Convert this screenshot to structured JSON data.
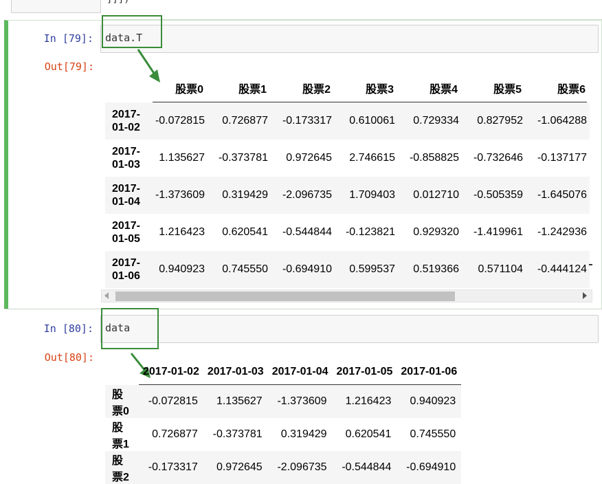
{
  "prev_cell": {
    "code_tail": "]]])"
  },
  "cell79": {
    "in_prompt": "In  [79]:",
    "out_prompt": "Out[79]:",
    "code": "data.T",
    "table": {
      "columns": [
        "股票0",
        "股票1",
        "股票2",
        "股票3",
        "股票4",
        "股票5",
        "股票6"
      ],
      "rows": [
        {
          "index": [
            "2017-",
            "01-02"
          ],
          "values": [
            "-0.072815",
            "0.726877",
            "-0.173317",
            "0.610061",
            "0.729334",
            "0.827952",
            "-1.064288"
          ]
        },
        {
          "index": [
            "2017-",
            "01-03"
          ],
          "values": [
            "1.135627",
            "-0.373781",
            "0.972645",
            "2.746615",
            "-0.858825",
            "-0.732646",
            "-0.137177"
          ]
        },
        {
          "index": [
            "2017-",
            "01-04"
          ],
          "values": [
            "-1.373609",
            "0.319429",
            "-2.096735",
            "1.709403",
            "0.012710",
            "-0.505359",
            "-1.645076"
          ]
        },
        {
          "index": [
            "2017-",
            "01-05"
          ],
          "values": [
            "1.216423",
            "0.620541",
            "-0.544844",
            "-0.123821",
            "0.929320",
            "-1.419961",
            "-1.242936"
          ]
        },
        {
          "index": [
            "2017-",
            "01-06"
          ],
          "values": [
            "0.940923",
            "0.745550",
            "-0.694910",
            "0.599537",
            "0.519366",
            "0.571104",
            "-0.444124"
          ]
        }
      ]
    }
  },
  "cell80": {
    "in_prompt": "In  [80]:",
    "out_prompt": "Out[80]:",
    "code": "data",
    "table": {
      "columns": [
        "2017-01-02",
        "2017-01-03",
        "2017-01-04",
        "2017-01-05",
        "2017-01-06"
      ],
      "rows": [
        {
          "index": "股票0",
          "values": [
            "-0.072815",
            "1.135627",
            "-1.373609",
            "1.216423",
            "0.940923"
          ]
        },
        {
          "index": "股票1",
          "values": [
            "0.726877",
            "-0.373781",
            "0.319429",
            "0.620541",
            "0.745550"
          ]
        },
        {
          "index": "股票2",
          "values": [
            "-0.173317",
            "0.972645",
            "-2.096735",
            "-0.544844",
            "-0.694910"
          ]
        }
      ]
    }
  },
  "colors": {
    "selected_cell_bar": "#5cb85c",
    "annotation_green": "#3a8c3a",
    "in_prompt": "#303f9f",
    "out_prompt": "#d84315"
  }
}
